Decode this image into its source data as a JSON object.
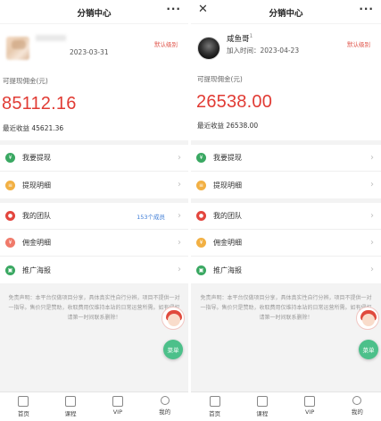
{
  "screens": [
    {
      "title": "分销中心",
      "date": "2023-03-31",
      "level_badge": "默认级别",
      "withdraw_label": "可提现佣金(元)",
      "amount": "85112.16",
      "recent_income": "最近收益 45621.36",
      "menu_group1": [
        {
          "label": "我要提现",
          "icon": "wallet-icon"
        },
        {
          "label": "提现明细",
          "icon": "receipt-icon"
        }
      ],
      "menu_group2": [
        {
          "label": "我的团队",
          "icon": "team-icon",
          "extra": "153个成员"
        },
        {
          "label": "佣金明细",
          "icon": "commission-icon"
        },
        {
          "label": "推广海报",
          "icon": "poster-icon"
        }
      ],
      "disclaimer": "免责声明：本平台仅做项目分享，具体真实性自行分辨，项目不提供一对一指导。售价只是赞助，收取费用仅维持本站的日常运营所需。如有侵权请第一时间联系删除！",
      "fab_label": "菜单",
      "tabs": [
        {
          "label": "首页",
          "icon": "home-icon"
        },
        {
          "label": "课程",
          "icon": "course-icon"
        },
        {
          "label": "VIP",
          "icon": "vip-icon"
        },
        {
          "label": "我的",
          "icon": "profile-icon"
        }
      ]
    },
    {
      "title": "分销中心",
      "name": "咸鱼哥",
      "name_sup": "1",
      "join_date": "加入时间：2023-04-23",
      "level_badge": "默认级别",
      "withdraw_label": "可提现佣金(元)",
      "amount": "26538.00",
      "recent_income": "最近收益 26538.00",
      "menu_group1": [
        {
          "label": "我要提现",
          "icon": "wallet-icon"
        },
        {
          "label": "提现明细",
          "icon": "receipt-icon"
        }
      ],
      "menu_group2": [
        {
          "label": "我的团队",
          "icon": "team-icon"
        },
        {
          "label": "佣金明细",
          "icon": "commission-icon"
        },
        {
          "label": "推广海报",
          "icon": "poster-icon"
        }
      ],
      "disclaimer": "免责声明：本平台仅做项目分享，具体真实性自行分辨，项目不提供一对一指导。售价只是赞助，收取费用仅维持本站的日常运营所需。如有侵权请第一时间联系删除！",
      "fab_label": "菜单",
      "tabs": [
        {
          "label": "首页",
          "icon": "home-icon"
        },
        {
          "label": "课程",
          "icon": "course-icon"
        },
        {
          "label": "VIP",
          "icon": "vip-icon"
        },
        {
          "label": "我的",
          "icon": "profile-icon"
        }
      ]
    }
  ]
}
